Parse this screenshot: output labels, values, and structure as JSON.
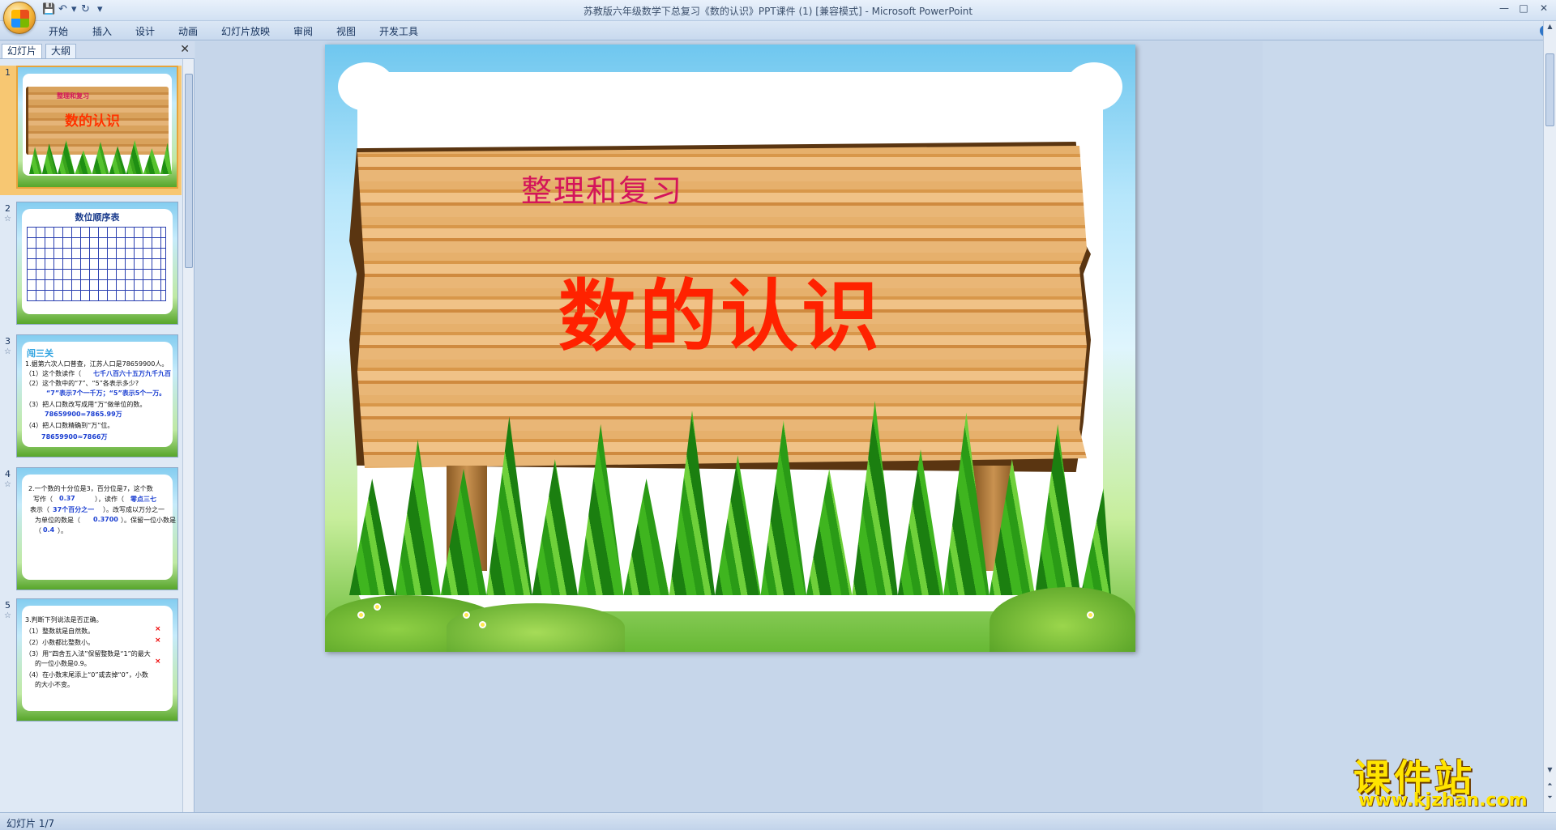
{
  "window": {
    "title": "苏教版六年级数学下总复习《数的认识》PPT课件 (1) [兼容模式] - Microsoft PowerPoint",
    "controls": {
      "minimize": "—",
      "maximize": "□",
      "close": "✕"
    }
  },
  "quick_access": {
    "dropdown": "▾"
  },
  "ribbon": {
    "tabs": [
      "开始",
      "插入",
      "设计",
      "动画",
      "幻灯片放映",
      "审阅",
      "视图",
      "开发工具"
    ],
    "help": "?"
  },
  "panel": {
    "tabs": [
      "幻灯片",
      "大纲"
    ],
    "close": "✕"
  },
  "thumbnails": [
    {
      "number": "1",
      "subtitle": "整理和复习",
      "title": "数的认识"
    },
    {
      "number": "2",
      "title": "数位顺序表"
    },
    {
      "number": "3",
      "heading": "闯三关",
      "lines": [
        "1.据第六次人口普查，江苏人口是78659900人。",
        "（1）这个数读作（",
        "（2）这个数中的“7”、“5”各表示多少?",
        "（3）把人口数改写成用“万”做单位的数。",
        "（4）把人口数精确到“万”位。"
      ],
      "answers": [
        "七千八百六十五万九千九百",
        "“7”表示7个一千万；“5”表示5个一万。",
        "78659900=7865.99万",
        "78659900≈7866万"
      ]
    },
    {
      "number": "4",
      "lines": [
        "2.一个数的十分位是3，百分位是7，这个数",
        "写作（",
        "），读作（",
        "表示（",
        "）。改写成以万分之一",
        "为单位的数是（",
        "）。保留一位小数是",
        "（",
        "）。"
      ],
      "answers": [
        "0.37",
        "零点三七",
        "37个百分之一",
        "0.3700",
        "0.4"
      ]
    },
    {
      "number": "5",
      "lines": [
        "3.判断下列说法是否正确。",
        "（1）整数就是自然数。",
        "（2）小数都比整数小。",
        "（3）用“四舍五入法”保留整数是“1”的最大",
        "的一位小数是0.9。",
        "（4）在小数末尾添上“0”或去掉“0”，小数",
        "的大小不变。"
      ],
      "marks": [
        "×",
        "×",
        "×"
      ]
    }
  ],
  "slide": {
    "subtitle": "整理和复习",
    "title": "数的认识"
  },
  "status": {
    "text": "幻灯片 1/7"
  },
  "watermark": {
    "title": "课件站",
    "url": "www.kjzhan.com"
  }
}
